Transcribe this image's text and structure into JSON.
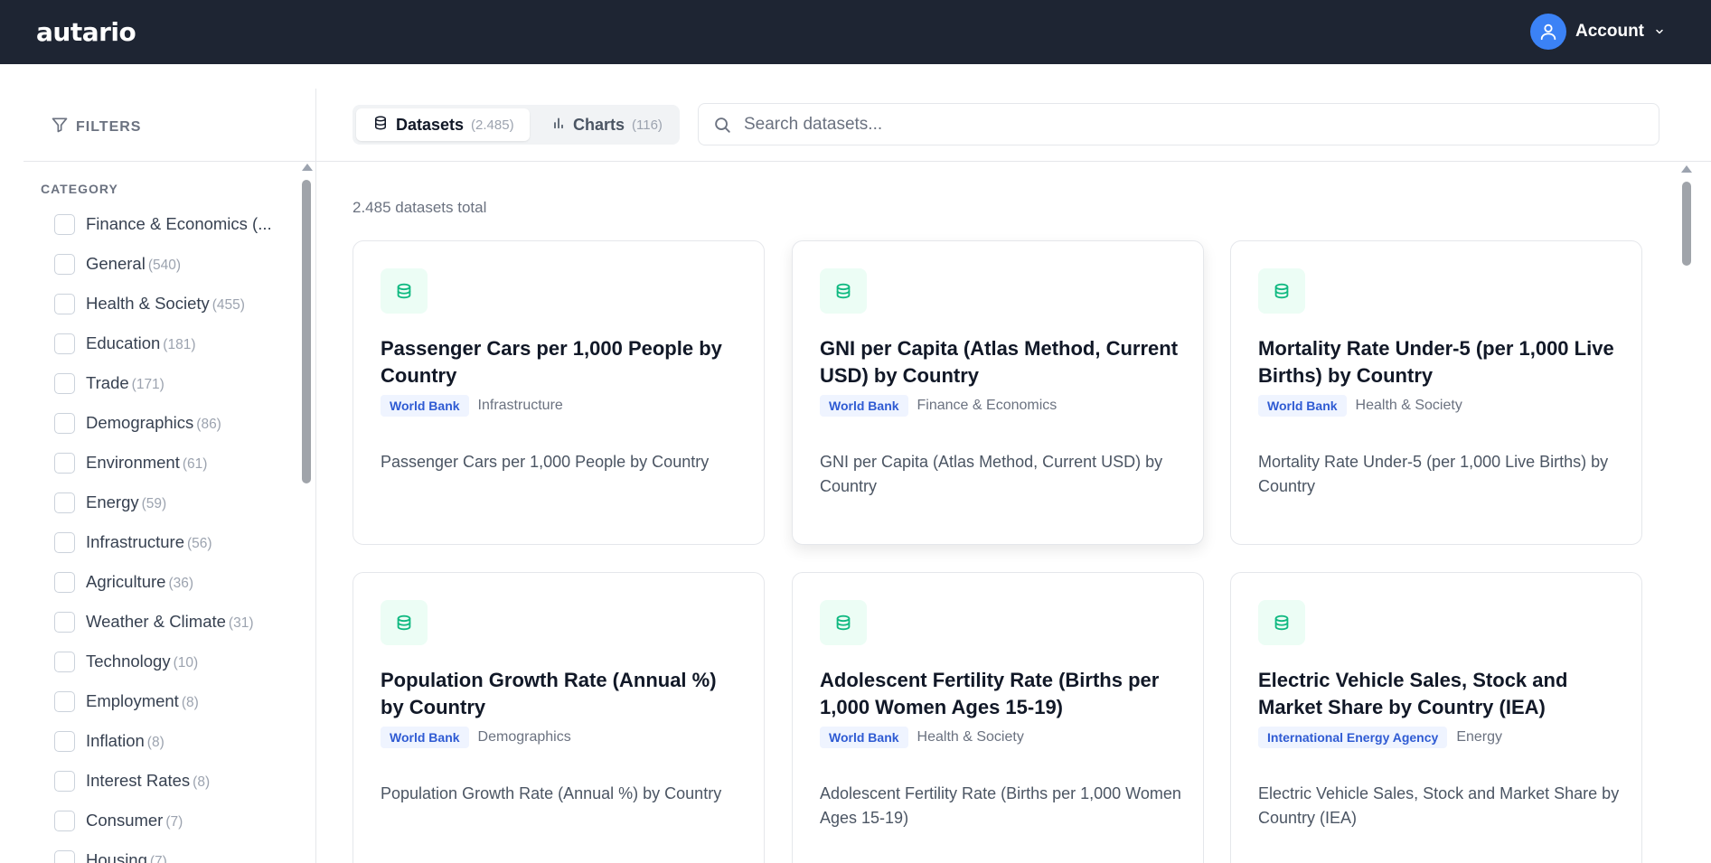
{
  "app": {
    "logo": "autario"
  },
  "account": {
    "label": "Account",
    "avatar_icon": "user-icon",
    "chevron_icon": "chevron-down-icon"
  },
  "sidebar": {
    "filters_label": "FILTERS",
    "category_title": "CATEGORY",
    "categories": [
      {
        "name": "Finance & Economics (...",
        "count": ""
      },
      {
        "name": "General",
        "count": "(540)"
      },
      {
        "name": "Health & Society",
        "count": "(455)"
      },
      {
        "name": "Education",
        "count": "(181)"
      },
      {
        "name": "Trade",
        "count": "(171)"
      },
      {
        "name": "Demographics",
        "count": "(86)"
      },
      {
        "name": "Environment",
        "count": "(61)"
      },
      {
        "name": "Energy",
        "count": "(59)"
      },
      {
        "name": "Infrastructure",
        "count": "(56)"
      },
      {
        "name": "Agriculture",
        "count": "(36)"
      },
      {
        "name": "Weather & Climate",
        "count": "(31)"
      },
      {
        "name": "Technology",
        "count": "(10)"
      },
      {
        "name": "Employment",
        "count": "(8)"
      },
      {
        "name": "Inflation",
        "count": "(8)"
      },
      {
        "name": "Interest Rates",
        "count": "(8)"
      },
      {
        "name": "Consumer",
        "count": "(7)"
      },
      {
        "name": "Housing",
        "count": "(7)"
      }
    ]
  },
  "tabs": [
    {
      "label": "Datasets",
      "count": "(2.485)",
      "active": true
    },
    {
      "label": "Charts",
      "count": "(116)",
      "active": false
    }
  ],
  "search": {
    "placeholder": "Search datasets...",
    "value": ""
  },
  "main": {
    "total_text": "2.485 datasets total"
  },
  "cards": [
    {
      "title": "Passenger Cars per 1,000 People by Country",
      "source": "World Bank",
      "category": "Infrastructure",
      "description": "Passenger Cars per 1,000 People by Country"
    },
    {
      "title": "GNI per Capita (Atlas Method, Current USD) by Country",
      "source": "World Bank",
      "category": "Finance & Economics",
      "description": "GNI per Capita (Atlas Method, Current USD) by Country"
    },
    {
      "title": "Mortality Rate Under-5 (per 1,000 Live Births) by Country",
      "source": "World Bank",
      "category": "Health & Society",
      "description": "Mortality Rate Under-5 (per 1,000 Live Births) by Country"
    },
    {
      "title": "Population Growth Rate (Annual %) by Country",
      "source": "World Bank",
      "category": "Demographics",
      "description": "Population Growth Rate (Annual %) by Country"
    },
    {
      "title": "Adolescent Fertility Rate (Births per 1,000 Women Ages 15-19)",
      "source": "World Bank",
      "category": "Health & Society",
      "description": "Adolescent Fertility Rate (Births per 1,000 Women Ages 15-19)"
    },
    {
      "title": "Electric Vehicle Sales, Stock and Market Share by Country (IEA)",
      "source": "International Energy Agency",
      "category": "Energy",
      "description": "Electric Vehicle Sales, Stock and Market Share by Country (IEA)"
    }
  ],
  "colors": {
    "topbar": "#1e2533",
    "accent": "#3b82f6",
    "icon_green": "#10b981",
    "badge_text": "#2f5bd3"
  }
}
